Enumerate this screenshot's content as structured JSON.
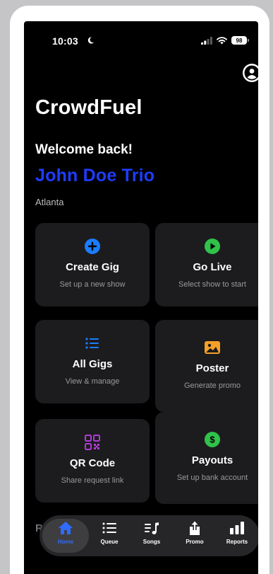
{
  "status_bar": {
    "time": "10:03",
    "battery": "98"
  },
  "app": {
    "title": "CrowdFuel"
  },
  "greeting": {
    "welcome": "Welcome back!",
    "artist": "John Doe Trio",
    "city": "Atlanta"
  },
  "tiles": [
    {
      "title": "Create Gig",
      "subtitle": "Set up a new show",
      "icon": "plus-circle-icon",
      "color": "#1a7cff"
    },
    {
      "title": "Go Live",
      "subtitle": "Select show to start",
      "icon": "play-circle-icon",
      "color": "#30c24a"
    },
    {
      "title": "All Gigs",
      "subtitle": "View & manage",
      "icon": "list-icon",
      "color": "#1a7cff"
    },
    {
      "title": "Poster",
      "subtitle": "Generate promo",
      "icon": "photo-icon",
      "color": "#f5a028"
    },
    {
      "title": "QR Code",
      "subtitle": "Share request link",
      "icon": "qr-code-icon",
      "color": "#b13bd6"
    },
    {
      "title": "Payouts",
      "subtitle": "Set up bank account",
      "icon": "dollar-circle-icon",
      "color": "#30c24a"
    }
  ],
  "section_partial": "R",
  "tab_bar": {
    "active_color": "#2f6bff",
    "tabs": [
      {
        "label": "Home",
        "icon": "house-icon",
        "active": true
      },
      {
        "label": "Queue",
        "icon": "list-icon",
        "active": false
      },
      {
        "label": "Songs",
        "icon": "music-note-list-icon",
        "active": false
      },
      {
        "label": "Promo",
        "icon": "share-icon",
        "active": false
      },
      {
        "label": "Reports",
        "icon": "bar-chart-icon",
        "active": false
      }
    ]
  }
}
